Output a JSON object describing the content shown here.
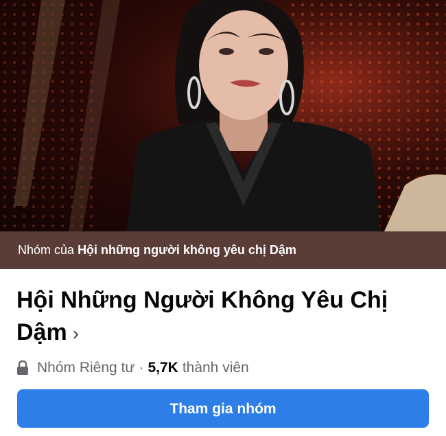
{
  "cover": {
    "icon": "cover-photo"
  },
  "owner_bar": {
    "prefix": "Nhóm của",
    "owner_name": "Hội những người không yêu chị Dậm"
  },
  "group": {
    "title": "Hội Những Người Không Yêu Chị Dậm",
    "chevron": "›",
    "privacy_icon": "lock-icon",
    "privacy": "Nhóm Riêng tư",
    "separator": "·",
    "member_count": "5,7K",
    "member_label": "thành viên"
  },
  "join_button": {
    "label": "Tham gia nhóm"
  },
  "colors": {
    "owner_bar_bg": "#5b3d38",
    "button_bg": "#2d7ee6",
    "meta_text": "#65676b"
  }
}
